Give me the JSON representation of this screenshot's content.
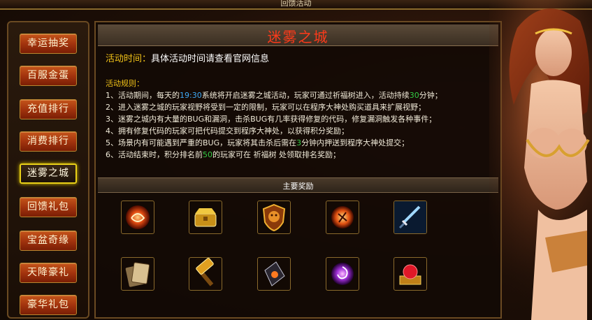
{
  "window": {
    "title": "回馈活动"
  },
  "sidebar": {
    "items": [
      {
        "label": "幸运抽奖",
        "active": false
      },
      {
        "label": "百服金蛋",
        "active": false
      },
      {
        "label": "充值排行",
        "active": false
      },
      {
        "label": "消费排行",
        "active": false
      },
      {
        "label": "迷雾之城",
        "active": true
      },
      {
        "label": "回馈礼包",
        "active": false
      },
      {
        "label": "宝盆奇缘",
        "active": false
      },
      {
        "label": "天降豪礼",
        "active": false
      },
      {
        "label": "豪华礼包",
        "active": false
      }
    ]
  },
  "event": {
    "title": "迷雾之城",
    "time_label": "活动时间：",
    "time_value": "具体活动时间请查看官网信息",
    "rules_title": "活动规则：",
    "rules": [
      {
        "a": "1、活动期间，每天的",
        "b": "19:30",
        "c": "系统将开启迷雾之城活动，玩家可通过祈福树进入，活动持续",
        "d": "30",
        "e": "分钟；"
      },
      {
        "text": "2、进入迷雾之城的玩家视野将受到一定的限制，玩家可以在程序大神处购买道具来扩展视野；"
      },
      {
        "text": "3、迷雾之城内有大量的BUG和漏洞，击杀BUG有几率获得修复的代码，修复漏洞触发各种事件；"
      },
      {
        "text": "4、拥有修复代码的玩家可把代码提交到程序大神处，以获得积分奖励；"
      },
      {
        "a": "5、场景内有可能遇到严重的BUG，玩家将其击杀后需在",
        "b": "3",
        "c": "分钟内押送到程序大神处提交；"
      },
      {
        "a": "6、活动结束时，积分排名前",
        "b": "50",
        "c": "的玩家可在 祈福树 处领取排名奖励；"
      }
    ],
    "rewards_title": "主要奖励",
    "rewards": [
      {
        "icon": "red-orb-icon",
        "color": "#d83a10"
      },
      {
        "icon": "gold-chest-icon",
        "color": "#d8a820"
      },
      {
        "icon": "lion-shield-icon",
        "color": "#b86a18"
      },
      {
        "icon": "fire-rune-icon",
        "color": "#e85a10"
      },
      {
        "icon": "blue-sword-icon",
        "color": "#3a8ae0"
      },
      {
        "icon": "scroll-cards-icon",
        "color": "#a89060"
      },
      {
        "icon": "golden-hammer-icon",
        "color": "#c87818"
      },
      {
        "icon": "dark-crystal-icon",
        "color": "#5a4a6a"
      },
      {
        "icon": "purple-vortex-icon",
        "color": "#a030d8"
      },
      {
        "icon": "ruby-gem-icon",
        "color": "#d8182a"
      }
    ]
  },
  "portrait": {
    "icon": "goddess-portrait-icon"
  },
  "colors": {
    "accent_gold": "#f2c318",
    "title_red": "#ff3a1a",
    "highlight_blue": "#3fa9f5",
    "highlight_green": "#33cc44"
  }
}
